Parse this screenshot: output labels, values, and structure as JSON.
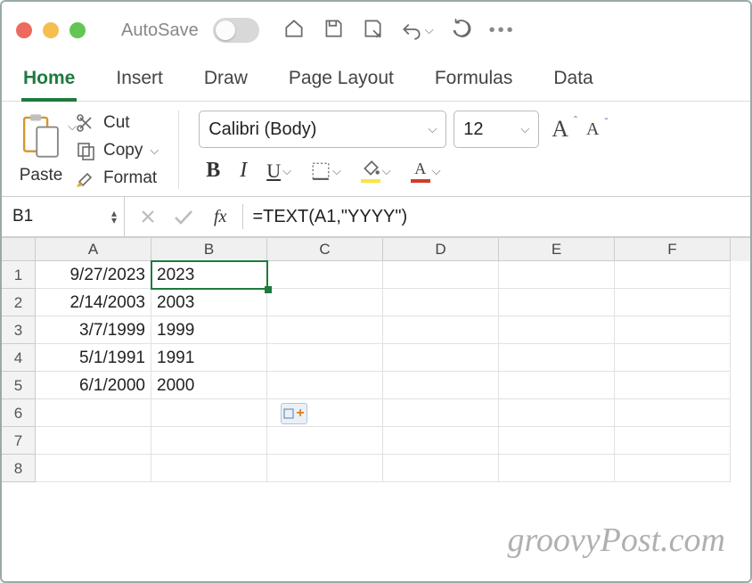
{
  "titlebar": {
    "autosave": "AutoSave"
  },
  "tabs": [
    "Home",
    "Insert",
    "Draw",
    "Page Layout",
    "Formulas",
    "Data"
  ],
  "active_tab": 0,
  "clipboard": {
    "paste": "Paste",
    "cut": "Cut",
    "copy": "Copy",
    "format": "Format"
  },
  "font": {
    "name": "Calibri (Body)",
    "size": "12",
    "bold": "B",
    "italic": "I",
    "underline": "U"
  },
  "namebox": "B1",
  "fx_label": "fx",
  "formula": "=TEXT(A1,\"YYYY\")",
  "columns": [
    "A",
    "B",
    "C",
    "D",
    "E",
    "F"
  ],
  "rows": [
    {
      "n": "1",
      "A": "9/27/2023",
      "B": "2023"
    },
    {
      "n": "2",
      "A": "2/14/2003",
      "B": "2003"
    },
    {
      "n": "3",
      "A": "3/7/1999",
      "B": "1999"
    },
    {
      "n": "4",
      "A": "5/1/1991",
      "B": "1991"
    },
    {
      "n": "5",
      "A": "6/1/2000",
      "B": "2000"
    },
    {
      "n": "6"
    },
    {
      "n": "7"
    },
    {
      "n": "8"
    }
  ],
  "selection": {
    "col": 1,
    "row": 0
  },
  "watermark": "groovyPost.com",
  "colors": {
    "accent": "#1f7a3e",
    "highlight": "#ffe244",
    "fontcolor": "#d63a2a"
  }
}
